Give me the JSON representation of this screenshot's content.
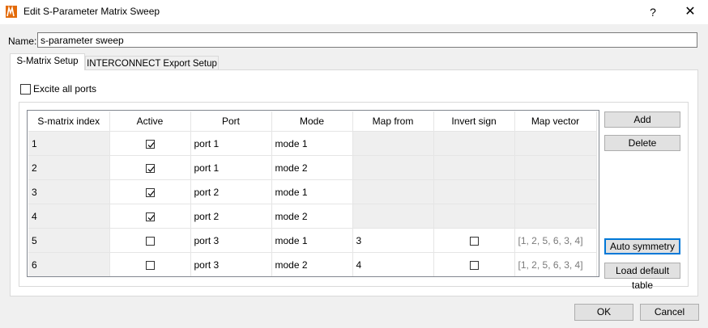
{
  "window": {
    "title": "Edit S-Parameter Matrix Sweep",
    "help_glyph": "?",
    "close_glyph": "✕",
    "icon": "lumerical-app-icon"
  },
  "name": {
    "label": "Name:",
    "value": "s-parameter sweep"
  },
  "tabs": [
    {
      "label": "S-Matrix Setup",
      "active": true
    },
    {
      "label": "INTERCONNECT Export Setup",
      "active": false
    }
  ],
  "excite_all_ports": {
    "label": "Excite all ports",
    "checked": false
  },
  "table": {
    "columns": [
      "S-matrix index",
      "Active",
      "Port",
      "Mode",
      "Map from",
      "Invert sign",
      "Map vector"
    ],
    "rows": [
      {
        "index": "1",
        "active": true,
        "port": "port 1",
        "mode": "mode 1",
        "map_from": "",
        "invert_sign": null,
        "map_vector": ""
      },
      {
        "index": "2",
        "active": true,
        "port": "port 1",
        "mode": "mode 2",
        "map_from": "",
        "invert_sign": null,
        "map_vector": ""
      },
      {
        "index": "3",
        "active": true,
        "port": "port 2",
        "mode": "mode 1",
        "map_from": "",
        "invert_sign": null,
        "map_vector": ""
      },
      {
        "index": "4",
        "active": true,
        "port": "port 2",
        "mode": "mode 2",
        "map_from": "",
        "invert_sign": null,
        "map_vector": ""
      },
      {
        "index": "5",
        "active": false,
        "port": "port 3",
        "mode": "mode 1",
        "map_from": "3",
        "invert_sign": false,
        "map_vector": "[1, 2, 5, 6, 3, 4]"
      },
      {
        "index": "6",
        "active": false,
        "port": "port 3",
        "mode": "mode 2",
        "map_from": "4",
        "invert_sign": false,
        "map_vector": "[1, 2, 5, 6, 3, 4]"
      }
    ]
  },
  "side_buttons": {
    "add": "Add",
    "delete": "Delete",
    "auto_symmetry": "Auto symmetry",
    "load_default": "Load default table"
  },
  "footer": {
    "ok": "OK",
    "cancel": "Cancel"
  },
  "colors": {
    "focus_border": "#0078d7",
    "gray_cell": "#efefef",
    "window_bg": "#f0f0f0"
  }
}
